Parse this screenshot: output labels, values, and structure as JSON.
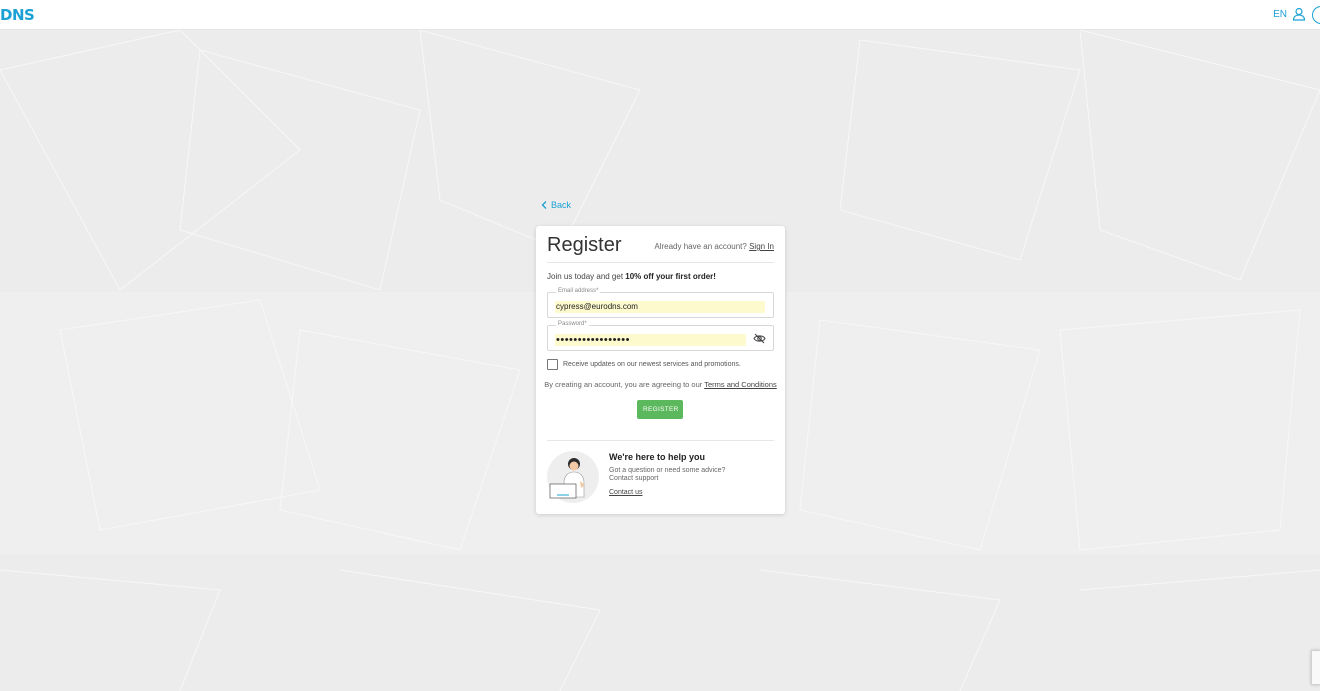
{
  "header": {
    "logo_text": "DNS",
    "language": "EN",
    "user_icon": "user-icon",
    "brand_color": "#1ba1d5"
  },
  "back": {
    "label": "Back",
    "icon": "chevron-left-icon"
  },
  "card": {
    "title": "Register",
    "already_text": "Already have an account?",
    "signin_label": "Sign In",
    "intro_text": "Join us today and get ",
    "intro_bold": "10% off your first order!",
    "email": {
      "label": "Email address*",
      "value": "cypress@eurodns.com"
    },
    "password": {
      "label": "Password*",
      "value": "•••••••••••••••••",
      "toggle_icon": "eye-off-icon"
    },
    "newsletter_label": "Receive updates on our newest services and promotions.",
    "terms_text": "By creating an account, you are agreeing to our ",
    "terms_link": "Terms and Conditions",
    "register_label": "REGISTER",
    "register_color": "#5cb85c"
  },
  "help": {
    "title": "We're here to help you",
    "line1": "Got a question or need some advice?",
    "line2": "Contact support",
    "link": "Contact us"
  }
}
